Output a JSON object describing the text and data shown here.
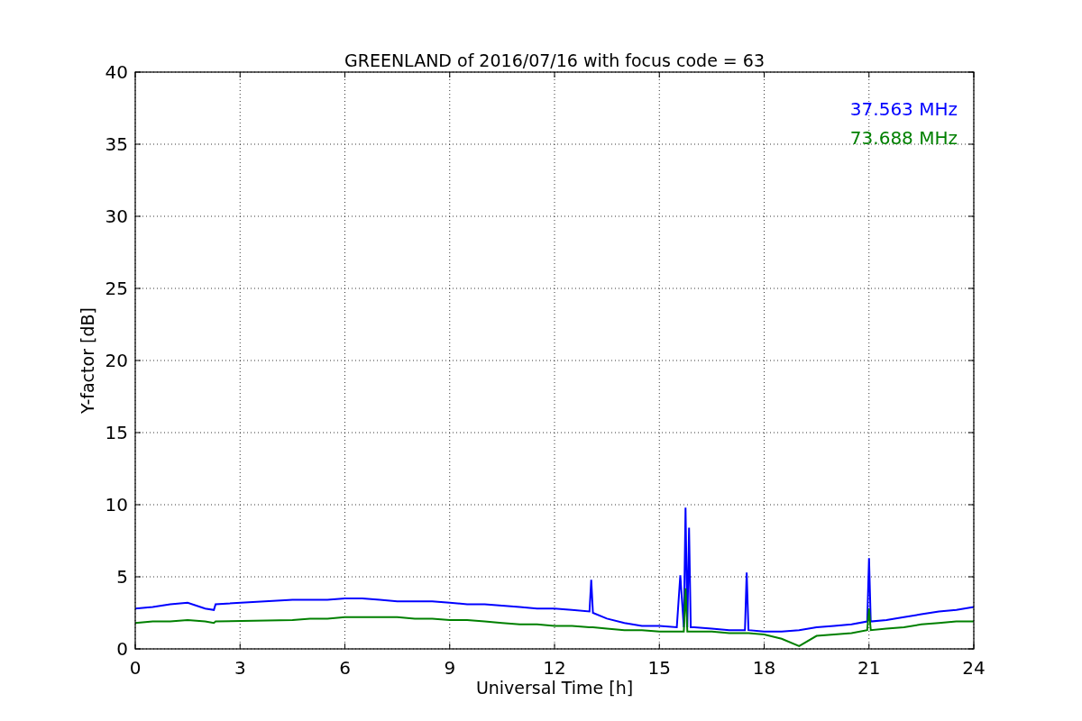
{
  "chart_data": {
    "type": "line",
    "title": "GREENLAND of 2016/07/16 with focus code = 63",
    "xlabel": "Universal Time [h]",
    "ylabel": "Y-factor [dB]",
    "x": [
      0,
      0.5,
      1,
      1.5,
      2,
      2.25,
      2.3,
      4.5,
      5,
      5.5,
      6,
      6.5,
      7,
      7.5,
      8,
      8.5,
      9,
      9.5,
      10,
      10.5,
      11,
      11.5,
      12,
      12.5,
      13,
      13.05,
      13.1,
      13.5,
      14,
      14.5,
      15,
      15.5,
      15.6,
      15.7,
      15.75,
      15.8,
      15.85,
      15.9,
      16,
      16.5,
      17,
      17.45,
      17.5,
      17.55,
      18,
      18.5,
      19,
      19.5,
      20,
      20.5,
      20.95,
      21,
      21.05,
      21.5,
      22,
      22.5,
      23,
      23.5,
      24
    ],
    "series": [
      {
        "name": "37.563 MHz",
        "color": "#0000ff",
        "values": [
          2.8,
          2.9,
          3.1,
          3.2,
          2.8,
          2.7,
          3.1,
          3.4,
          3.4,
          3.4,
          3.5,
          3.5,
          3.4,
          3.3,
          3.3,
          3.3,
          3.2,
          3.1,
          3.1,
          3.0,
          2.9,
          2.8,
          2.8,
          2.7,
          2.6,
          4.8,
          2.5,
          2.1,
          1.8,
          1.6,
          1.6,
          1.5,
          5.1,
          1.5,
          9.8,
          1.5,
          8.4,
          1.5,
          1.5,
          1.4,
          1.3,
          1.3,
          5.3,
          1.3,
          1.2,
          1.2,
          1.3,
          1.5,
          1.6,
          1.7,
          1.9,
          6.3,
          1.9,
          2.0,
          2.2,
          2.4,
          2.6,
          2.7,
          2.9
        ]
      },
      {
        "name": "73.688 MHz",
        "color": "#008000",
        "values": [
          1.8,
          1.9,
          1.9,
          2.0,
          1.9,
          1.8,
          1.9,
          2.0,
          2.1,
          2.1,
          2.2,
          2.2,
          2.2,
          2.2,
          2.1,
          2.1,
          2.0,
          2.0,
          1.9,
          1.8,
          1.7,
          1.7,
          1.6,
          1.6,
          1.5,
          1.5,
          1.5,
          1.4,
          1.3,
          1.3,
          1.2,
          1.2,
          1.2,
          1.2,
          4.2,
          1.2,
          1.2,
          1.2,
          1.2,
          1.2,
          1.1,
          1.1,
          1.1,
          1.1,
          1.0,
          0.7,
          0.2,
          0.9,
          1.0,
          1.1,
          1.3,
          2.8,
          1.3,
          1.4,
          1.5,
          1.7,
          1.8,
          1.9,
          1.9
        ]
      }
    ],
    "xlim": [
      0,
      24
    ],
    "ylim": [
      0,
      40
    ],
    "xticks": [
      0,
      3,
      6,
      9,
      12,
      15,
      18,
      21,
      24
    ],
    "yticks": [
      0,
      5,
      10,
      15,
      20,
      25,
      30,
      35,
      40
    ],
    "grid": true
  }
}
